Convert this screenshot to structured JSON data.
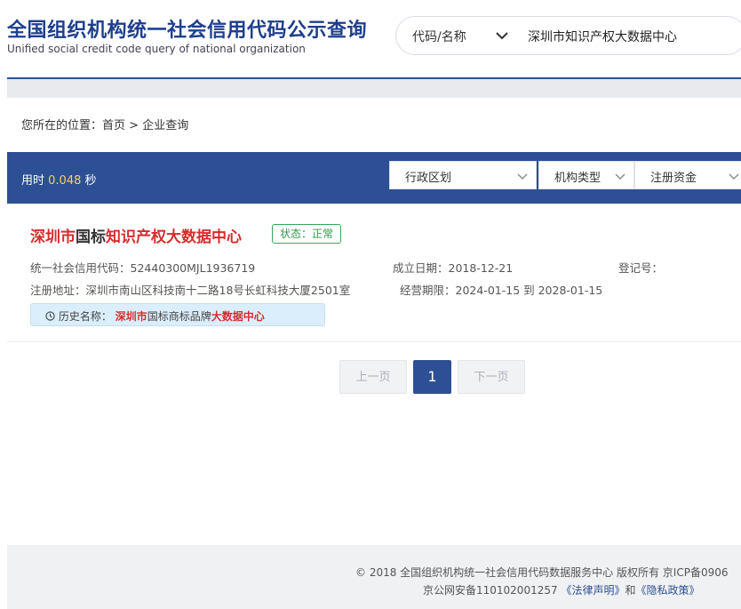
{
  "header": {
    "title": "全国组织机构统一社会信用代码公示查询",
    "subtitle": "Unified social credit code query of national organization"
  },
  "search": {
    "type_label": "代码/名称",
    "value": "深圳市知识产权大数据中心"
  },
  "breadcrumb": {
    "prefix": "您所在的位置：",
    "home": "首页",
    "separator": " > ",
    "current": "企业查询"
  },
  "summary": {
    "time_label": "用时",
    "time_value": "0.048",
    "time_unit": "秒"
  },
  "filters": [
    {
      "label": "行政区划"
    },
    {
      "label": "机构类型"
    },
    {
      "label": "注册资金"
    }
  ],
  "result": {
    "name_parts": [
      "深圳市",
      "国标",
      "知识产权大数据中心"
    ],
    "status": "状态：正常",
    "credit_code_label": "统一社会信用代码：",
    "credit_code": "52440300MJL1936719",
    "established_label": "成立日期：",
    "established": "2018-12-21",
    "reg_no_label": "登记号：",
    "address_label": "注册地址：",
    "address": "深圳市南山区科技南十二路18号长虹科技大厦2501室",
    "period_label": "经营期限：",
    "period": "2024-01-15 到 2028-01-15",
    "history_label": "历史名称：",
    "history_parts": [
      "深圳市",
      "国标商标品牌",
      "大数据中心"
    ]
  },
  "pagination": {
    "prev": "上一页",
    "current": "1",
    "next": "下一页"
  },
  "footer": {
    "copyright": "© 2018 全国组织机构统一社会信用代码数据服务中心 版权所有 京ICP备0906",
    "beian": "京公网安备110102001257",
    "legal": "《法律声明》",
    "and": "和",
    "privacy": "《隐私政策》"
  },
  "colors": {
    "brand": "#2d4f93",
    "highlight": "#d62c2c",
    "status": "#2f9a4a",
    "timing": "#ffd24a"
  }
}
